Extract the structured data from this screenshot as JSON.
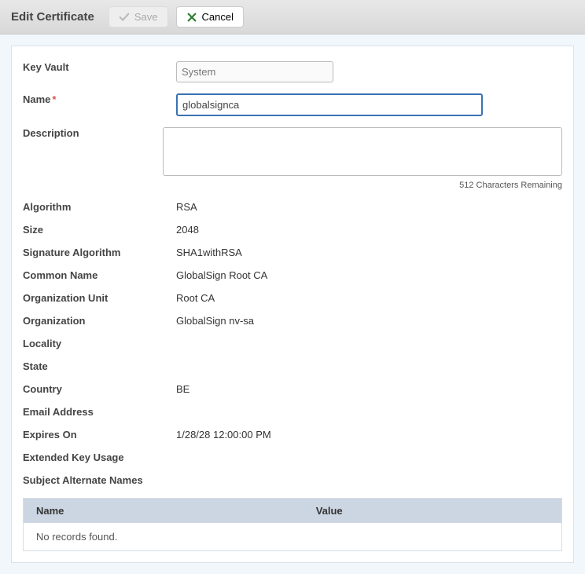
{
  "header": {
    "title": "Edit Certificate",
    "save_label": "Save",
    "cancel_label": "Cancel"
  },
  "form": {
    "key_vault_label": "Key Vault",
    "key_vault_placeholder": "System",
    "name_label": "Name",
    "name_value": "globalsignca",
    "description_label": "Description",
    "description_value": "",
    "char_counter": "512 Characters Remaining",
    "algorithm_label": "Algorithm",
    "algorithm_value": "RSA",
    "size_label": "Size",
    "size_value": "2048",
    "sig_alg_label": "Signature Algorithm",
    "sig_alg_value": "SHA1withRSA",
    "common_name_label": "Common Name",
    "common_name_value": "GlobalSign Root CA",
    "ou_label": "Organization Unit",
    "ou_value": "Root CA",
    "org_label": "Organization",
    "org_value": "GlobalSign nv-sa",
    "locality_label": "Locality",
    "locality_value": "",
    "state_label": "State",
    "state_value": "",
    "country_label": "Country",
    "country_value": "BE",
    "email_label": "Email Address",
    "email_value": "",
    "expires_label": "Expires On",
    "expires_value": "1/28/28 12:00:00 PM",
    "eku_label": "Extended Key Usage",
    "eku_value": "",
    "san_label": "Subject Alternate Names"
  },
  "table": {
    "col_name": "Name",
    "col_value": "Value",
    "empty": "No records found."
  }
}
